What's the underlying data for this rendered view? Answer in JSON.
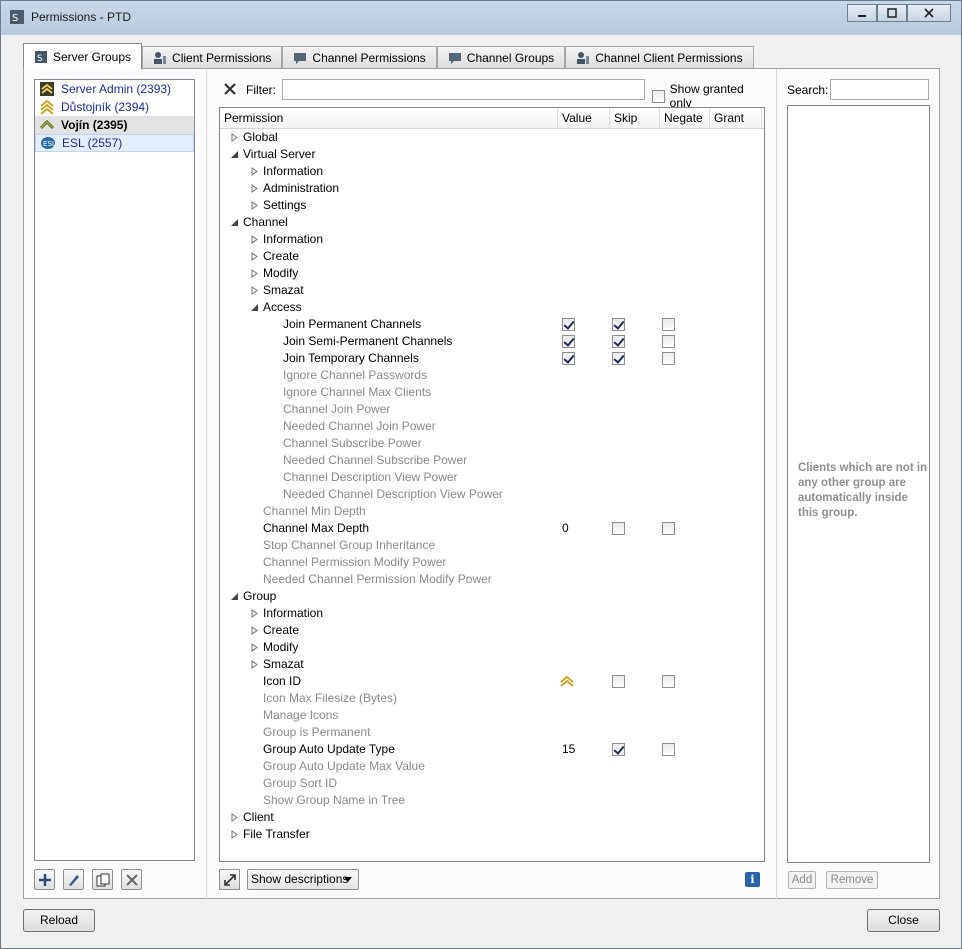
{
  "window": {
    "title": "Permissions - PTD"
  },
  "tabs": [
    {
      "label": "Server Groups"
    },
    {
      "label": "Client Permissions"
    },
    {
      "label": "Channel Permissions"
    },
    {
      "label": "Channel Groups"
    },
    {
      "label": "Channel Client Permissions"
    }
  ],
  "groups": [
    {
      "label": "Server Admin (2393)"
    },
    {
      "label": "Důstojník (2394)"
    },
    {
      "label": "Vojín (2395)"
    },
    {
      "label": "ESL (2557)"
    }
  ],
  "filter": {
    "label": "Filter:",
    "value": "",
    "show_granted_label": "Show granted only"
  },
  "table": {
    "headers": {
      "permission": "Permission",
      "value": "Value",
      "skip": "Skip",
      "negate": "Negate",
      "grant": "Grant"
    },
    "rows": [
      {
        "label": "Global"
      },
      {
        "label": "Virtual Server"
      },
      {
        "label": "Information"
      },
      {
        "label": "Administration"
      },
      {
        "label": "Settings"
      },
      {
        "label": "Channel"
      },
      {
        "label": "Information"
      },
      {
        "label": "Create"
      },
      {
        "label": "Modify"
      },
      {
        "label": "Smazat"
      },
      {
        "label": "Access"
      },
      {
        "label": "Join Permanent Channels"
      },
      {
        "label": "Join Semi-Permanent Channels"
      },
      {
        "label": "Join Temporary Channels"
      },
      {
        "label": "Ignore Channel Passwords"
      },
      {
        "label": "Ignore Channel Max Clients"
      },
      {
        "label": "Channel Join Power"
      },
      {
        "label": "Needed Channel Join Power"
      },
      {
        "label": "Channel Subscribe Power"
      },
      {
        "label": "Needed Channel Subscribe Power"
      },
      {
        "label": "Channel Description View Power"
      },
      {
        "label": "Needed Channel Description View Power"
      },
      {
        "label": "Channel Min Depth"
      },
      {
        "label": "Channel Max Depth",
        "value": "0"
      },
      {
        "label": "Stop Channel Group Inheritance"
      },
      {
        "label": "Channel Permission Modify Power"
      },
      {
        "label": "Needed Channel Permission Modify Power"
      },
      {
        "label": "Group"
      },
      {
        "label": "Information"
      },
      {
        "label": "Create"
      },
      {
        "label": "Modify"
      },
      {
        "label": "Smazat"
      },
      {
        "label": "Icon ID"
      },
      {
        "label": "Icon Max Filesize (Bytes)"
      },
      {
        "label": "Manage Icons"
      },
      {
        "label": "Group is Permanent"
      },
      {
        "label": "Group Auto Update Type",
        "value": "15"
      },
      {
        "label": "Group Auto Update Max Value"
      },
      {
        "label": "Group Sort ID"
      },
      {
        "label": "Show Group Name in Tree"
      },
      {
        "label": "Client"
      },
      {
        "label": "File Transfer"
      }
    ]
  },
  "bottom": {
    "descriptions_select": "Show descriptions"
  },
  "clients": {
    "search_label": "Search:",
    "search_value": "",
    "note": "Clients which are not in any other group are automatically inside this group.",
    "add_label": "Add",
    "remove_label": "Remove"
  },
  "footer": {
    "reload_label": "Reload",
    "close_label": "Close"
  },
  "icons": {
    "titlebar": "permissions-icon",
    "group_icons": [
      "sergeant-rank-icon",
      "officer-rank-icon",
      "private-rank-icon",
      "esl-icon"
    ],
    "info": "info-icon"
  },
  "colors": {
    "group_text": "#1c2c96",
    "dim_text": "#8a8a8a"
  }
}
